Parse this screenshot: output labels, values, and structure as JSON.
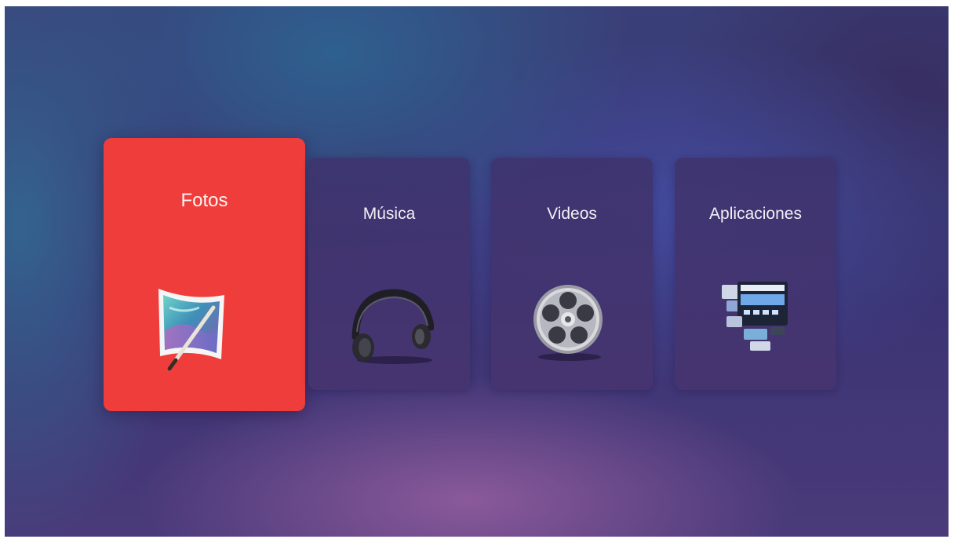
{
  "menu": {
    "items": [
      {
        "label": "Fotos",
        "icon": "photos-icon",
        "selected": true
      },
      {
        "label": "Música",
        "icon": "headphones-icon",
        "selected": false
      },
      {
        "label": "Videos",
        "icon": "film-reel-icon",
        "selected": false
      },
      {
        "label": "Aplicaciones",
        "icon": "apps-icon",
        "selected": false
      }
    ]
  },
  "colors": {
    "active_tile": "#ef3d3b",
    "tile": "#41356f",
    "background": "#3b3474"
  }
}
